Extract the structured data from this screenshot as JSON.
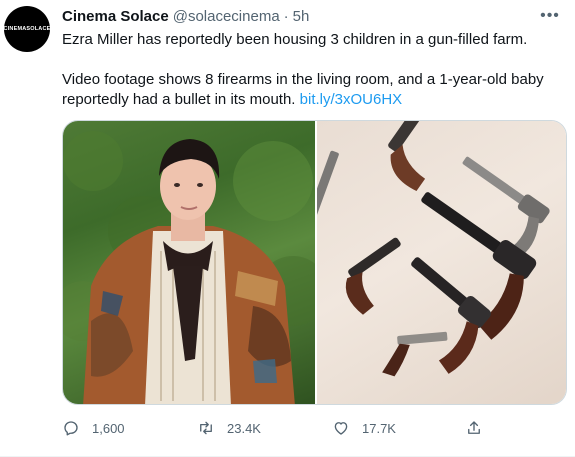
{
  "author": {
    "avatar_text": "CINEMASOLACE",
    "name": "Cinema Solace",
    "handle": "@solacecinema",
    "separator": "·",
    "time": "5h"
  },
  "tweet": {
    "line1": "Ezra Miller has reportedly been housing 3 children in a gun-filled farm.",
    "line2": "Video footage shows 8 firearms in the living room, and a 1-year-old baby reportedly had a bullet in its mouth.",
    "link": "bit.ly/3xOU6HX"
  },
  "media": {
    "left_image": "person-photo",
    "right_image": "firearms-photo"
  },
  "actions": {
    "replies": "1,600",
    "retweets": "23.4K",
    "likes": "17.7K"
  },
  "icons": {
    "more": "more-icon",
    "reply": "reply-icon",
    "retweet": "retweet-icon",
    "like": "heart-icon",
    "share": "share-icon"
  },
  "colors": {
    "text": "#0f1419",
    "secondary": "#536471",
    "link": "#1d9bf0",
    "border": "#cfd9de"
  }
}
